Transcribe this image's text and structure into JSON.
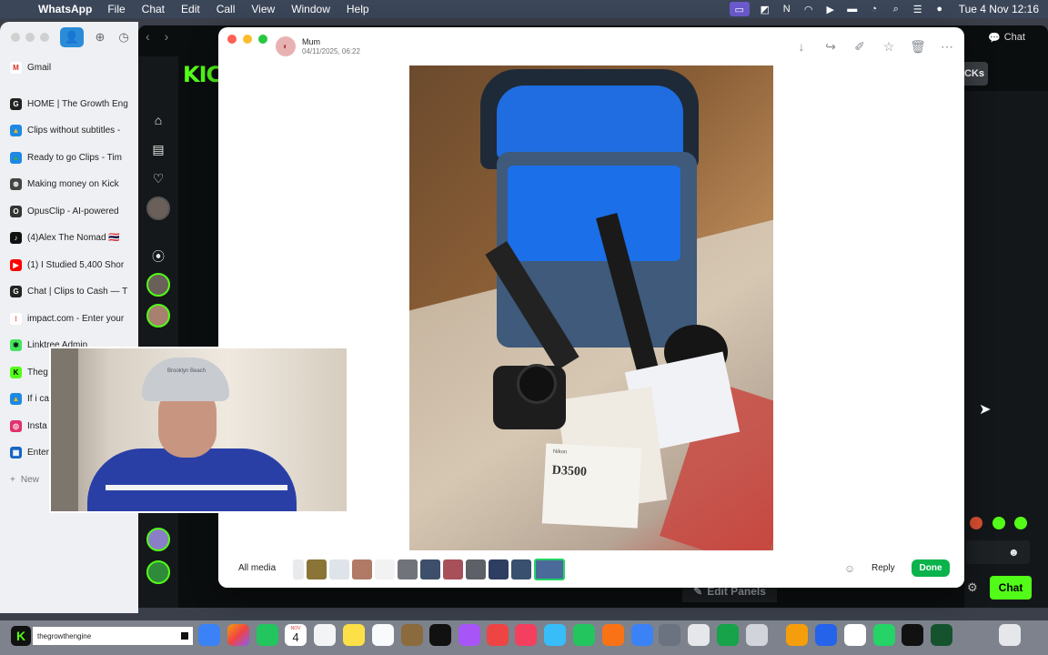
{
  "menubar": {
    "app_name": "WhatsApp",
    "menus": [
      "File",
      "Chat",
      "Edit",
      "Call",
      "View",
      "Window",
      "Help"
    ],
    "clock": "Tue 4 Nov  12:16"
  },
  "browser_sidebar": {
    "tabs": [
      {
        "label": "Gmail",
        "color": "#ffffff",
        "glyph": "M",
        "glyph_color": "#d93025"
      },
      {
        "label": "HOME | The Growth Eng",
        "color": "#222222",
        "glyph": "G",
        "glyph_color": "#ffffff"
      },
      {
        "label": "Clips without subtitles -",
        "color": "#1e88e5",
        "glyph": "▲",
        "glyph_color": "#fbbc04"
      },
      {
        "label": "Ready to go Clips - Tim",
        "color": "#1e88e5",
        "glyph": "▲",
        "glyph_color": "#34a853"
      },
      {
        "label": "Making money on Kick",
        "color": "#444444",
        "glyph": "⊛",
        "glyph_color": "#ffffff"
      },
      {
        "label": "OpusClip - AI-powered",
        "color": "#333333",
        "glyph": "O",
        "glyph_color": "#ffffff"
      },
      {
        "label": "(4)Alex The Nomad 🇹🇭",
        "color": "#111111",
        "glyph": "♪",
        "glyph_color": "#ffffff"
      },
      {
        "label": "(1) I Studied 5,400 Shor",
        "color": "#ff0000",
        "glyph": "▶",
        "glyph_color": "#ffffff"
      },
      {
        "label": "Chat | Clips to Cash — T",
        "color": "#222222",
        "glyph": "G",
        "glyph_color": "#ffffff"
      },
      {
        "label": "impact.com - Enter your",
        "color": "#ffffff",
        "glyph": "⁝",
        "glyph_color": "#e53935"
      },
      {
        "label": "Linktree Admin",
        "color": "#43e55e",
        "glyph": "✱",
        "glyph_color": "#111111"
      },
      {
        "label": "Theg",
        "color": "#53fc18",
        "glyph": "K",
        "glyph_color": "#000000"
      },
      {
        "label": "If i ca",
        "color": "#1e88e5",
        "glyph": "▲",
        "glyph_color": "#fbbc04"
      },
      {
        "label": "Insta",
        "color": "#e1306c",
        "glyph": "◎",
        "glyph_color": "#ffffff"
      },
      {
        "label": "Enter",
        "color": "#1565c0",
        "glyph": "▦",
        "glyph_color": "#ffffff"
      }
    ],
    "new_tab_label": "New"
  },
  "kick": {
    "logo": "KICK",
    "cks_label": "CKs",
    "chat_tab": "Chat",
    "chat_button": "Chat",
    "edit_panels": "Edit Panels"
  },
  "media_viewer": {
    "sender": "Mum",
    "date": "04/11/2025, 06:22",
    "manual_brand": "Nikon",
    "manual_title": "D3500",
    "all_media": "All media",
    "reply": "Reply",
    "done": "Done",
    "accent": "#0ab34c"
  },
  "webcam": {
    "cap_text": "Brooklyn Beach"
  },
  "dock": {
    "now_playing": "thegrowthengine",
    "calendar_month": "NOV",
    "calendar_day": "4"
  }
}
